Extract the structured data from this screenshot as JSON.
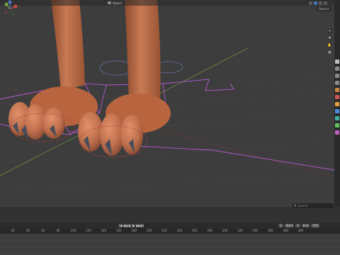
{
  "viewport": {
    "mode_label": "Object",
    "options_label": "Options",
    "gizmo_axes": [
      "x",
      "y",
      "z"
    ]
  },
  "nav_tools": [
    "+",
    "✥",
    "✋",
    "▦"
  ],
  "timeline": {
    "search_placeholder": "Search",
    "playback_buttons": [
      "|◀",
      "◀◀",
      "◀",
      "▶",
      "▶▶",
      "▶|"
    ],
    "frame_fields": [
      "1",
      "Start",
      "1",
      "End",
      "250"
    ],
    "ruler_ticks": [
      "20",
      "40",
      "60",
      "80",
      "100",
      "120",
      "140",
      "160",
      "180",
      "200",
      "220",
      "240",
      "260",
      "280",
      "300",
      "320",
      "340",
      "360",
      "380",
      "400"
    ]
  },
  "colors": {
    "accent": "#4772b3",
    "skin": "#c0704e",
    "claws": "#4a4e5a",
    "cage": "#b45ad2"
  }
}
